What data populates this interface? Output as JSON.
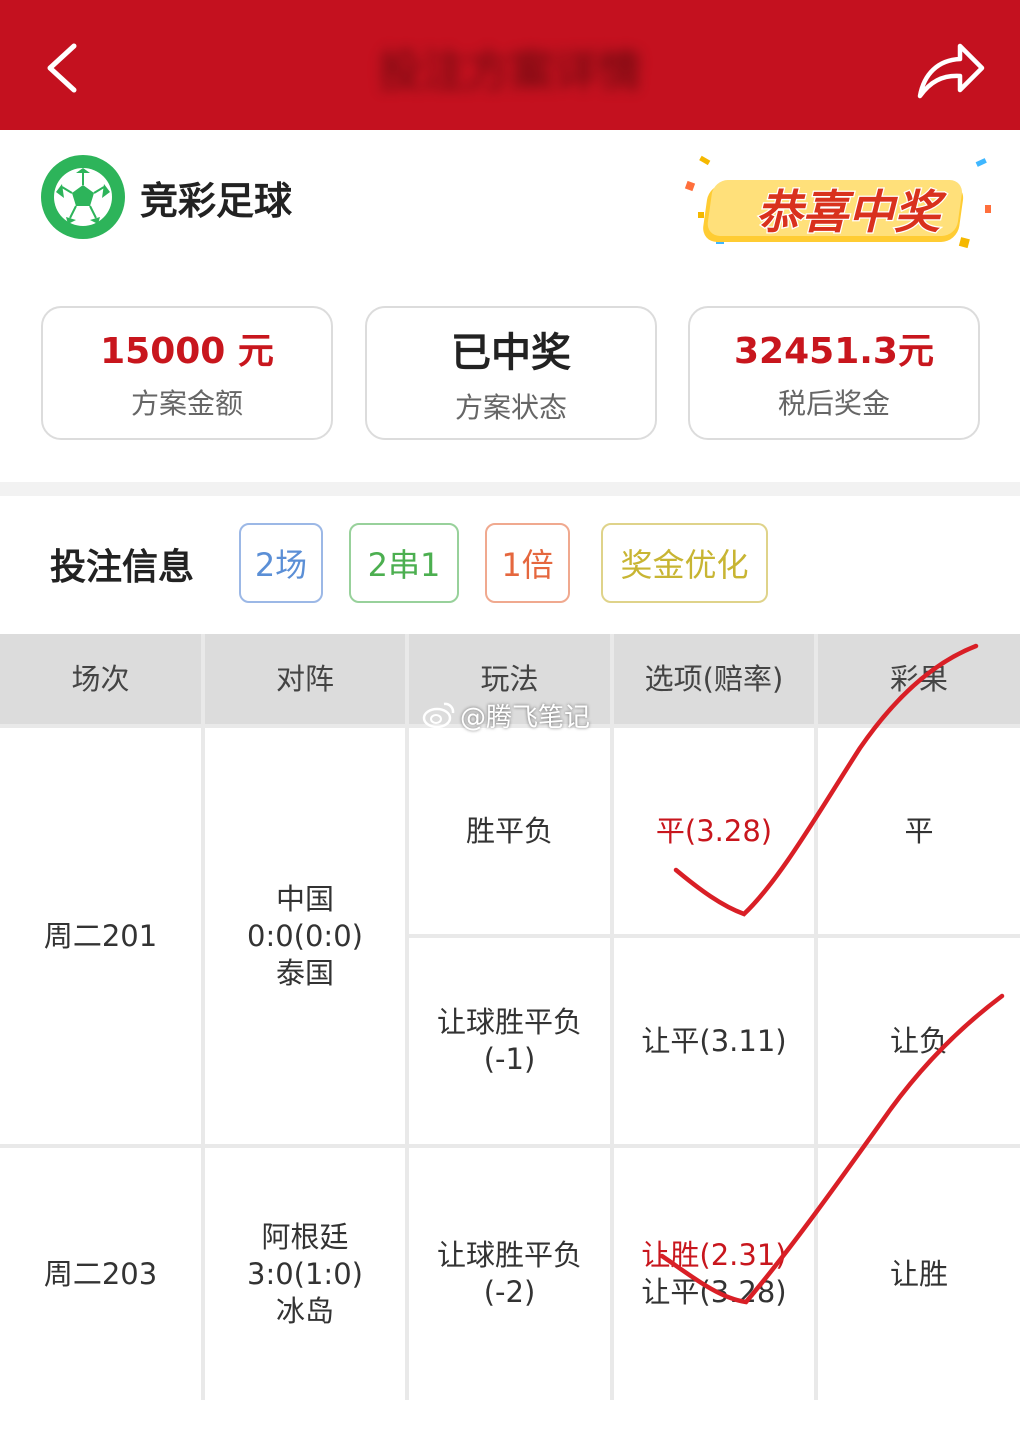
{
  "header": {
    "title": "投注方案详情",
    "back_icon": "chevron-left-icon",
    "share_icon": "share-icon",
    "bar_color": "#c4111f"
  },
  "brand": {
    "name": "竞彩足球",
    "icon": "soccer-ball-icon",
    "icon_color": "#2db45a"
  },
  "congrats_badge": {
    "text": "恭喜中奖"
  },
  "stats": [
    {
      "value": "15000 元",
      "label": "方案金额"
    },
    {
      "value": "已中奖",
      "label": "方案状态"
    },
    {
      "value": "32451.3元",
      "label": "税后奖金"
    }
  ],
  "bet_info": {
    "title": "投注信息",
    "tags": [
      {
        "label": "2场",
        "color": "#5b8fd6"
      },
      {
        "label": "2串1",
        "color": "#4caf50"
      },
      {
        "label": "1倍",
        "color": "#e5673e"
      },
      {
        "label": "奖金优化",
        "color": "#c8b533"
      }
    ]
  },
  "table": {
    "headers": [
      "场次",
      "对阵",
      "玩法",
      "选项(赔率)",
      "彩果"
    ],
    "matches": [
      {
        "id": "周二201",
        "home": "中国",
        "score": "0:0(0:0)",
        "away": "泰国",
        "plays": [
          {
            "type": "胜平负",
            "options": [
              "平(3.28)"
            ],
            "result": "平"
          },
          {
            "type": "让球胜平负",
            "handicap": "(-1)",
            "options": [
              "让平(3.11)"
            ],
            "result": "让负"
          }
        ]
      },
      {
        "id": "周二203",
        "home": "阿根廷",
        "score": "3:0(1:0)",
        "away": "冰岛",
        "plays": [
          {
            "type": "让球胜平负",
            "handicap": "(-2)",
            "options": [
              "让胜(2.31)",
              "让平(3.28)"
            ],
            "result": "让胜"
          }
        ]
      }
    ]
  },
  "watermark": {
    "text": "@腾飞笔记",
    "icon": "weibo-icon"
  }
}
